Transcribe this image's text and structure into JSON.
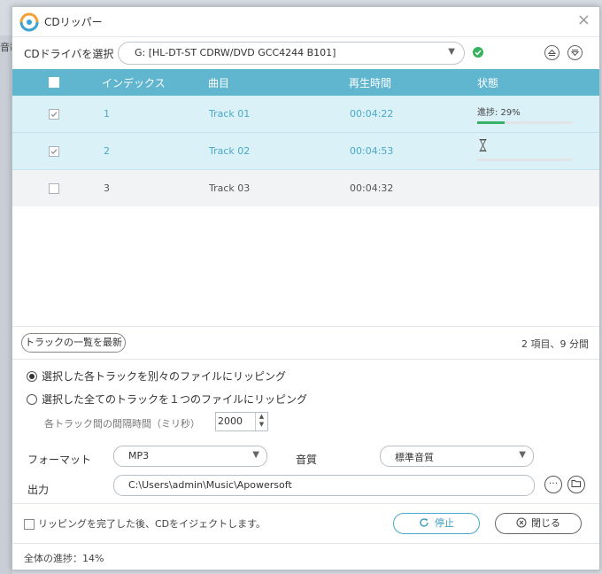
{
  "background": {
    "text": "音載"
  },
  "window": {
    "title": "CDリッパー"
  },
  "drive": {
    "label": "CDドライバを選択",
    "selected": "G: [HL-DT-ST CDRW/DVD GCC4244 B101]"
  },
  "table": {
    "headers": [
      "インデックス",
      "曲目",
      "再生時間",
      "状態"
    ],
    "rows": [
      {
        "index": "1",
        "title": "Track 01",
        "duration": "00:04:22",
        "checked": true,
        "status": "進捗: 29%",
        "progress": 0.29
      },
      {
        "index": "2",
        "title": "Track 02",
        "duration": "00:04:53",
        "checked": true,
        "status": "",
        "progress": 0
      },
      {
        "index": "3",
        "title": "Track 03",
        "duration": "00:04:32",
        "checked": false,
        "status": "",
        "progress": null
      }
    ]
  },
  "refresh_label": "トラックの一覧を最新",
  "summary": "2 項目、9 分間",
  "options": {
    "separate": "選択した各トラックを別々のファイルにリッピング",
    "single": "選択した全てのトラックを１つのファイルにリッピング",
    "gap_label": "各トラック間の間隔時間（ミリ秒）",
    "gap_value": "2000"
  },
  "format": {
    "label": "フォーマット",
    "value": "MP3"
  },
  "quality": {
    "label": "音質",
    "value": "標準音質"
  },
  "output": {
    "label": "出力",
    "path": "C:\\Users\\admin\\Music\\Apowersoft"
  },
  "eject_label": "リッピングを完了した後、CDをイジェクトします。",
  "buttons": {
    "stop": "停止",
    "close": "閉じる"
  },
  "overall_progress": "全体の進捗：14%",
  "colors": {
    "header": "#60b6cf",
    "selected_row": "#dbf1f8",
    "accent": "#4aa9c8",
    "progress": "#38b26b"
  }
}
